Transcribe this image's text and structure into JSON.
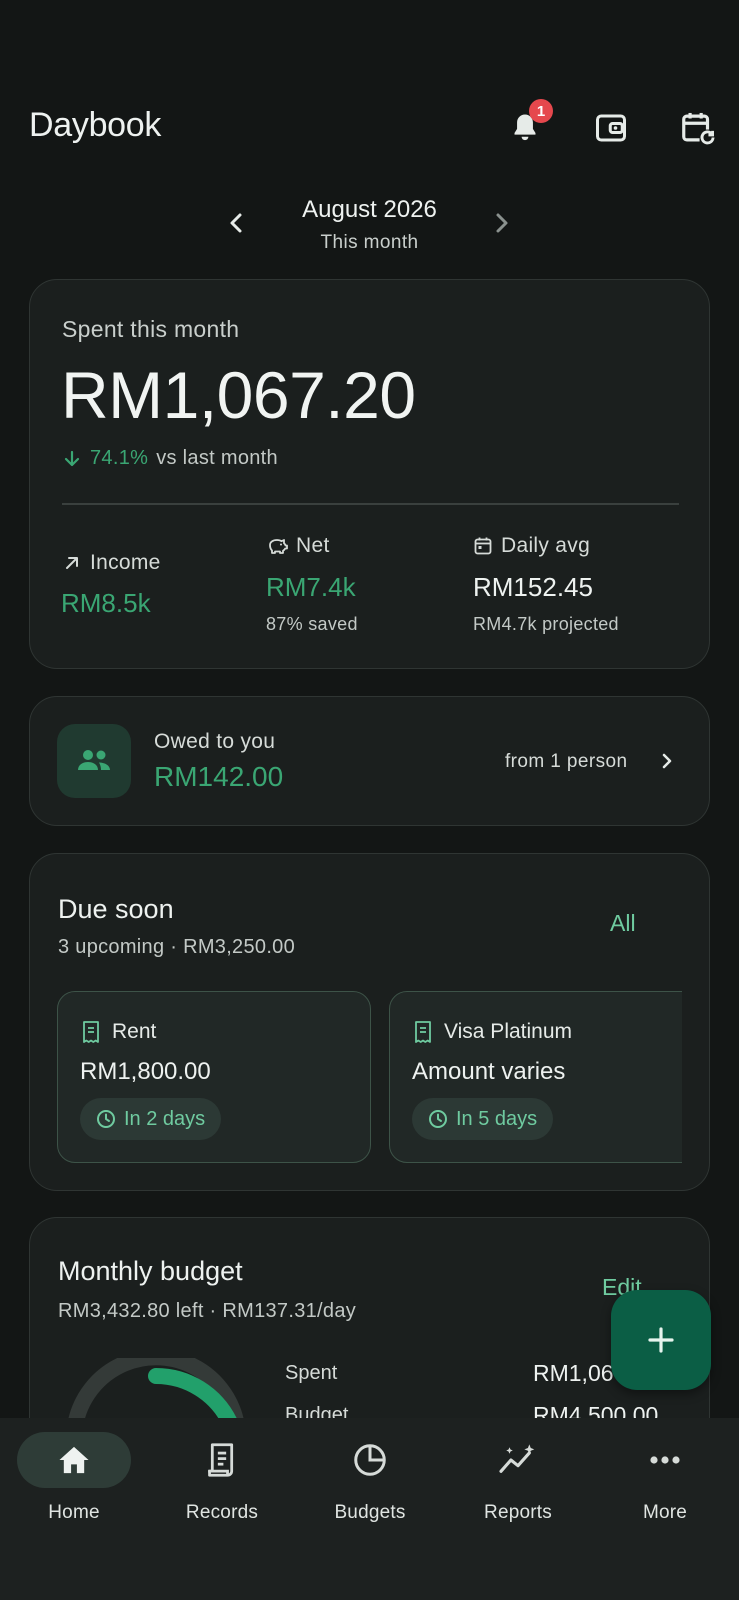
{
  "header": {
    "title": "Daybook",
    "notification_count": "1",
    "icons": [
      "bell-icon",
      "wallet-icon",
      "calendar-sync-icon"
    ]
  },
  "period": {
    "month": "August 2026",
    "label": "This month"
  },
  "summary": {
    "spent_label": "Spent this month",
    "spent_amount": "RM1,067.20",
    "trend_pct": "74.1%",
    "trend_text": "vs last month",
    "income_label": "Income",
    "income_value": "RM8.5k",
    "net_label": "Net",
    "net_value": "RM7.4k",
    "net_sub": "87% saved",
    "daily_label": "Daily avg",
    "daily_value": "RM152.45",
    "daily_sub": "RM4.7k projected"
  },
  "owed": {
    "label": "Owed to you",
    "amount": "RM142.00",
    "from": "from 1 person"
  },
  "due_soon": {
    "title": "Due soon",
    "subtitle": "3 upcoming · RM3,250.00",
    "all_label": "All",
    "bills": [
      {
        "name": "Rent",
        "amount": "RM1,800.00",
        "due": "In 2 days"
      },
      {
        "name": "Visa Platinum",
        "amount": "Amount varies",
        "due": "In 5 days"
      }
    ]
  },
  "budget": {
    "title": "Monthly budget",
    "subtitle": "RM3,432.80 left · RM137.31/day",
    "edit_label": "Edit",
    "spent_label": "Spent",
    "spent_value": "RM1,067.20",
    "budget_label": "Budget",
    "budget_value": "RM4,500.00",
    "spent_fraction": 0.237
  },
  "colors": {
    "background": "#131615",
    "card": "#1b1f1e",
    "accent": "#3aa673",
    "accent_light": "#6fcba0",
    "fab": "#0b5e45",
    "badge": "#e5484d"
  },
  "nav": {
    "items": [
      {
        "label": "Home",
        "icon": "home-icon"
      },
      {
        "label": "Records",
        "icon": "receipt-icon"
      },
      {
        "label": "Budgets",
        "icon": "pie-chart-icon"
      },
      {
        "label": "Reports",
        "icon": "trend-sparkle-icon"
      },
      {
        "label": "More",
        "icon": "more-dots-icon"
      }
    ]
  }
}
